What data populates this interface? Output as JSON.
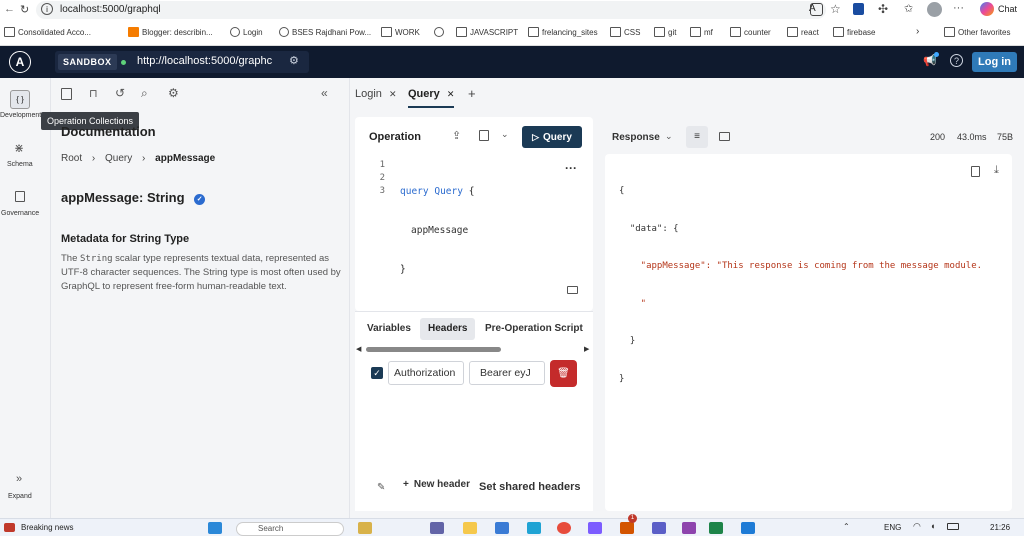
{
  "browser": {
    "url": "localhost:5000/graphql",
    "chat_label": "Chat"
  },
  "bookmarks": [
    {
      "label": "Consolidated Acco..."
    },
    {
      "label": "Blogger: describin..."
    },
    {
      "label": "Login"
    },
    {
      "label": "BSES Rajdhani Pow..."
    },
    {
      "label": "WORK"
    },
    {
      "label": "JAVASCRIPT"
    },
    {
      "label": "frelancing_sites"
    },
    {
      "label": "CSS"
    },
    {
      "label": "git"
    },
    {
      "label": "mf"
    },
    {
      "label": "counter"
    },
    {
      "label": "react"
    },
    {
      "label": "firebase"
    },
    {
      "label": "Other favorites"
    }
  ],
  "header": {
    "logo": "A",
    "sandbox_label": "SANDBOX",
    "endpoint": "http://localhost:5000/graphc",
    "login_label": "Log in"
  },
  "rail": {
    "development": "Development",
    "schema": "Schema",
    "governance": "Governance",
    "expand": "Expand"
  },
  "docs": {
    "tooltip": "Operation Collections",
    "title": "Documentation",
    "breadcrumb": [
      "Root",
      "Query",
      "appMessage"
    ],
    "field_name": "appMessage",
    "field_type": "String",
    "metadata_title": "Metadata for String Type",
    "desc_pre": "The ",
    "desc_code": "String",
    "desc_post": " scalar type represents textual data, represented as UTF-8 character sequences. The String type is most often used by GraphQL to represent free-form human-readable text."
  },
  "tabs": [
    {
      "label": "Login"
    },
    {
      "label": "Query"
    }
  ],
  "operation": {
    "title": "Operation",
    "run_label": "Query",
    "line_numbers": [
      "1",
      "2",
      "3"
    ],
    "code_keyword": "query",
    "code_name": "Query",
    "code_open": "{",
    "code_field": "appMessage",
    "code_close": "}"
  },
  "bottom_tabs": {
    "variables": "Variables",
    "headers": "Headers",
    "pre_op": "Pre-Operation Script"
  },
  "header_row": {
    "key": "Authorization",
    "value": "Bearer eyJ"
  },
  "footer_actions": {
    "new_header": "New header",
    "shared_headers": "Set shared headers"
  },
  "response": {
    "label": "Response",
    "status": "200",
    "time": "43.0ms",
    "size": "75B",
    "json_lines": [
      "{",
      "  \"data\": {",
      "    \"appMessage\": \"This response is coming from the message module.",
      "    \"",
      "  }",
      "}"
    ]
  },
  "taskbar": {
    "news": "Breaking news",
    "search": "Search",
    "lang": "ENG",
    "time": "21:26",
    "badge": "1"
  },
  "colors": {
    "header_bg": "#0f1a2e",
    "accent": "#1b3a55",
    "login_btn": "#2f7ab8",
    "delete": "#c42b2b",
    "string_red": "#b5361a",
    "keyword_blue": "#2b6bcf"
  }
}
